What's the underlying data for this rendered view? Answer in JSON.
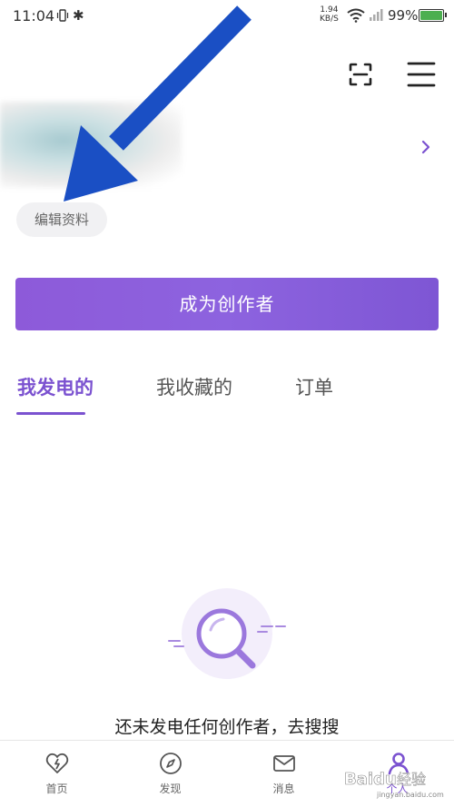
{
  "status_bar": {
    "time": "11:04",
    "net_speed_value": "1.94",
    "net_speed_unit": "KB/S",
    "battery": "99%"
  },
  "profile": {
    "edit_label": "编辑资料"
  },
  "creator_button_label": "成为创作者",
  "tabs": [
    {
      "label": "我发电的",
      "active": true
    },
    {
      "label": "我收藏的",
      "active": false
    },
    {
      "label": "订单",
      "active": false
    }
  ],
  "empty_state": {
    "text": "还未发电任何创作者，去搜搜"
  },
  "bottom_nav": [
    {
      "label": "首页",
      "icon": "heart-bolt-icon"
    },
    {
      "label": "发现",
      "icon": "compass-icon"
    },
    {
      "label": "消息",
      "icon": "mail-icon"
    },
    {
      "label": "个人",
      "icon": "person-icon",
      "active": true
    }
  ],
  "colors": {
    "accent": "#7b52d0",
    "annotation_arrow": "#1a4fc4"
  },
  "watermark": {
    "brand": "Baidu",
    "brand_cn": "经验",
    "domain": "jingyan.baidu.com"
  }
}
